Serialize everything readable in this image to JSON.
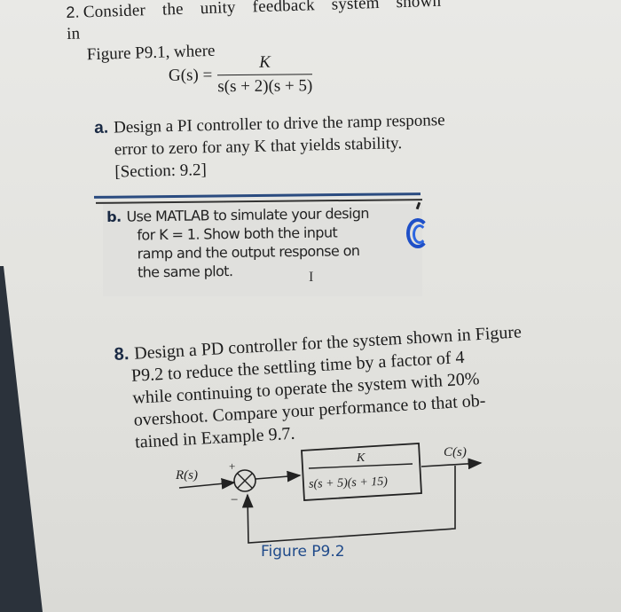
{
  "problem2": {
    "number": "2.",
    "line1": "Consider the unity feedback system shown in",
    "line2": "Figure P9.1, where",
    "equation": {
      "lhs": "G(s) =",
      "numerator": "K",
      "denominator": "s(s + 2)(s + 5)"
    },
    "part_a": {
      "label": "a.",
      "line1": "Design a PI controller to drive the ramp response",
      "line2": "error to zero for any K that yields stability.",
      "line3": "[Section: 9.2]"
    },
    "part_b": {
      "label": "b.",
      "line1": "Use MATLAB to simulate your design",
      "line2": "for K = 1. Show both the input",
      "line3": "ramp and the output response on",
      "line4": "the same plot."
    },
    "cursor_glyph": "I"
  },
  "problem8": {
    "number": "8.",
    "line1": "Design a PD controller for the system shown in Figure",
    "line2": "P9.2 to reduce the settling time by a factor of 4",
    "line3": "while continuing to operate the system with 20%",
    "line4": "overshoot. Compare your performance to that ob-",
    "line5": "tained in Example 9.7."
  },
  "figure": {
    "input_label": "R(s)",
    "output_label": "C(s)",
    "plus_sign": "+",
    "minus_sign": "−",
    "block_numerator": "K",
    "block_denominator": "s(s + 5)(s + 15)",
    "caption": "Figure P9.2"
  },
  "colors": {
    "caption_blue": "#1f4a8a",
    "rule_blue": "#2a4b80",
    "icon_blue": "#1e4fc7"
  }
}
